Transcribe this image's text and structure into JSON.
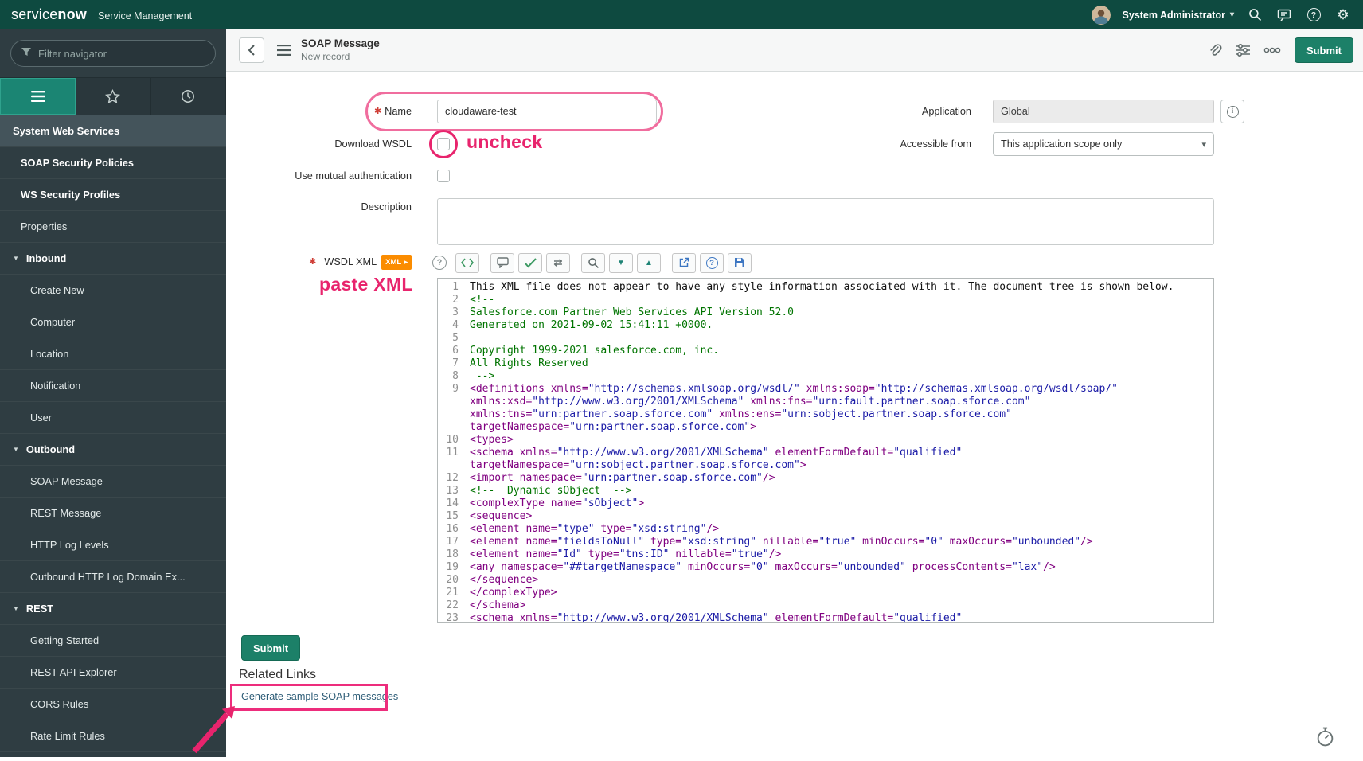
{
  "header": {
    "logo_light": "service",
    "logo_bold": "now",
    "product": "Service Management",
    "user_name": "System Administrator"
  },
  "sidebar": {
    "filter_placeholder": "Filter navigator",
    "items": [
      {
        "type": "app",
        "label": "System Web Services"
      },
      {
        "type": "module",
        "label": "SOAP Security Policies",
        "bold": true
      },
      {
        "type": "module",
        "label": "WS Security Profiles",
        "bold": true
      },
      {
        "type": "module",
        "label": "Properties",
        "bold": false
      },
      {
        "type": "group",
        "label": "Inbound"
      },
      {
        "type": "child",
        "label": "Create New"
      },
      {
        "type": "child",
        "label": "Computer"
      },
      {
        "type": "child",
        "label": "Location"
      },
      {
        "type": "child",
        "label": "Notification"
      },
      {
        "type": "child",
        "label": "User"
      },
      {
        "type": "group",
        "label": "Outbound"
      },
      {
        "type": "child",
        "label": "SOAP Message"
      },
      {
        "type": "child",
        "label": "REST Message"
      },
      {
        "type": "child",
        "label": "HTTP Log Levels"
      },
      {
        "type": "child",
        "label": "Outbound HTTP Log Domain Ex..."
      },
      {
        "type": "group",
        "label": "REST"
      },
      {
        "type": "child",
        "label": "Getting Started"
      },
      {
        "type": "child",
        "label": "REST API Explorer"
      },
      {
        "type": "child",
        "label": "CORS Rules"
      },
      {
        "type": "child",
        "label": "Rate Limit Rules"
      }
    ]
  },
  "form_header": {
    "title": "SOAP Message",
    "subtitle": "New record",
    "submit_label": "Submit"
  },
  "form": {
    "name": {
      "label": "Name",
      "value": "cloudaware-test",
      "mandatory": "✱"
    },
    "application": {
      "label": "Application",
      "value": "Global"
    },
    "download_wsdl": {
      "label": "Download WSDL"
    },
    "accessible_from": {
      "label": "Accessible from",
      "value": "This application scope only"
    },
    "mutual_auth": {
      "label": "Use mutual authentication"
    },
    "description": {
      "label": "Description",
      "value": ""
    },
    "wsdl_xml": {
      "label": "WSDL XML",
      "badge": "XML",
      "mandatory": "✱"
    }
  },
  "annotations": {
    "uncheck": "uncheck",
    "paste_xml": "paste XML"
  },
  "actions": {
    "submit_label": "Submit"
  },
  "related_links": {
    "title": "Related Links",
    "links": [
      "Generate sample SOAP messages"
    ]
  },
  "code": {
    "lines": [
      {
        "n": 1,
        "text": "This XML file does not appear to have any style information associated with it. The document tree is shown below."
      },
      {
        "n": 2,
        "text": "<!--"
      },
      {
        "n": 3,
        "text": "Salesforce.com Partner Web Services API Version 52.0"
      },
      {
        "n": 4,
        "text": "Generated on 2021-09-02 15:41:11 +0000."
      },
      {
        "n": 5,
        "text": ""
      },
      {
        "n": 6,
        "text": "Copyright 1999-2021 salesforce.com, inc."
      },
      {
        "n": 7,
        "text": "All Rights Reserved"
      },
      {
        "n": 8,
        "text": " -->"
      },
      {
        "n": 9,
        "text": "<definitions xmlns=\"http://schemas.xmlsoap.org/wsdl/\" xmlns:soap=\"http://schemas.xmlsoap.org/wsdl/soap/\" xmlns:xsd=\"http://www.w3.org/2001/XMLSchema\" xmlns:fns=\"urn:fault.partner.soap.sforce.com\" xmlns:tns=\"urn:partner.soap.sforce.com\" xmlns:ens=\"urn:sobject.partner.soap.sforce.com\" targetNamespace=\"urn:partner.soap.sforce.com\">"
      },
      {
        "n": 10,
        "text": "<types>"
      },
      {
        "n": 11,
        "text": "<schema xmlns=\"http://www.w3.org/2001/XMLSchema\" elementFormDefault=\"qualified\" targetNamespace=\"urn:sobject.partner.soap.sforce.com\">"
      },
      {
        "n": 12,
        "text": "<import namespace=\"urn:partner.soap.sforce.com\"/>"
      },
      {
        "n": 13,
        "text": "<!--  Dynamic sObject  -->"
      },
      {
        "n": 14,
        "text": "<complexType name=\"sObject\">"
      },
      {
        "n": 15,
        "text": "<sequence>"
      },
      {
        "n": 16,
        "text": "<element name=\"type\" type=\"xsd:string\"/>"
      },
      {
        "n": 17,
        "text": "<element name=\"fieldsToNull\" type=\"xsd:string\" nillable=\"true\" minOccurs=\"0\" maxOccurs=\"unbounded\"/>"
      },
      {
        "n": 18,
        "text": "<element name=\"Id\" type=\"tns:ID\" nillable=\"true\"/>"
      },
      {
        "n": 19,
        "text": "<any namespace=\"##targetNamespace\" minOccurs=\"0\" maxOccurs=\"unbounded\" processContents=\"lax\"/>"
      },
      {
        "n": 20,
        "text": "</sequence>"
      },
      {
        "n": 21,
        "text": "</complexType>"
      },
      {
        "n": 22,
        "text": "</schema>"
      },
      {
        "n": 23,
        "text": "<schema xmlns=\"http://www.w3.org/2001/XMLSchema\" elementFormDefault=\"qualified\" targetNamespace=\"urn:partner.soap.sforce.com\">"
      }
    ]
  }
}
